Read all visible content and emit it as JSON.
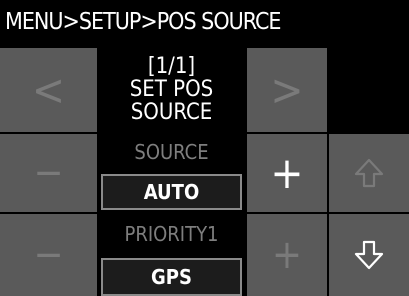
{
  "header": {
    "breadcrumb": "MENU>SETUP>POS SOURCE"
  },
  "page_indicator": {
    "page": "[1/1]",
    "line1": "SET POS",
    "line2": "SOURCE"
  },
  "nav": {
    "prev_label": "<",
    "next_label": ">"
  },
  "source_row": {
    "label": "SOURCE",
    "value": "AUTO",
    "decrement_label": "−",
    "increment_label": "+"
  },
  "priority_row": {
    "label": "PRIORITY1",
    "value": "GPS",
    "decrement_label": "−",
    "increment_label": "+"
  },
  "colors": {
    "background": "#000000",
    "button_fill": "#5a5a5a",
    "disabled_glyph": "#7a7a7a",
    "active_glyph": "#ffffff"
  },
  "icons": {
    "scroll_up": "up-arrow-outline-icon",
    "scroll_down": "down-arrow-outline-icon"
  }
}
